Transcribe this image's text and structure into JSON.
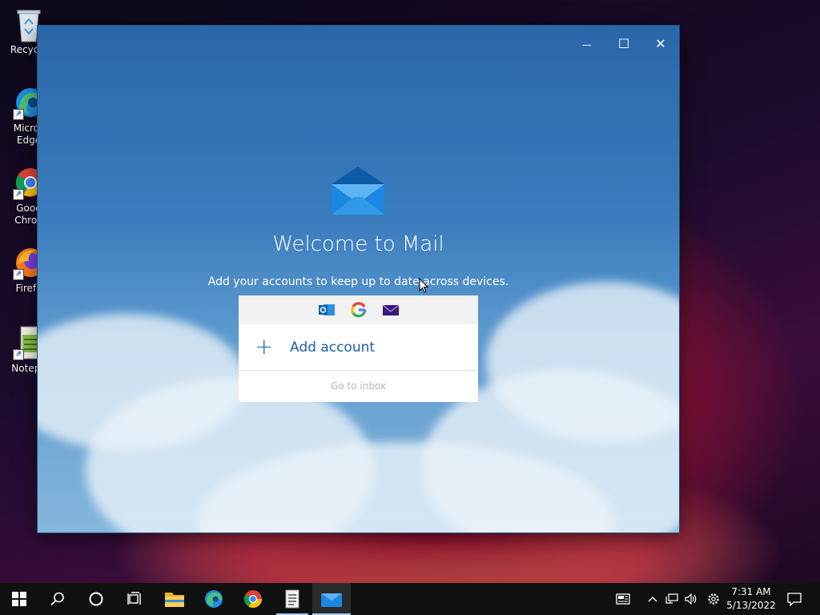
{
  "desktop": {
    "icons": [
      {
        "label": "Recycle",
        "icon": "recycle-bin-icon"
      },
      {
        "label": "Micros\nEdge",
        "line1": "Micros",
        "line2": "Edge",
        "icon": "edge-icon"
      },
      {
        "label": "Goog\nChron",
        "line1": "Goog",
        "line2": "Chron",
        "icon": "chrome-icon"
      },
      {
        "label": "Firefo",
        "icon": "firefox-icon"
      },
      {
        "label": "Notepa",
        "icon": "notepad-icon"
      }
    ]
  },
  "window": {
    "app": "Mail",
    "controls": {
      "minimize": "—",
      "maximize": "☐",
      "close": "✕"
    },
    "welcome_title": "Welcome to Mail",
    "welcome_subtitle": "Add your accounts to keep up to date across devices.",
    "providers": [
      "outlook-icon",
      "google-icon",
      "mail-icon"
    ],
    "add_account_label": "Add account",
    "add_account_icon": "plus-icon",
    "go_to_inbox_label": "Go to inbox"
  },
  "taskbar": {
    "apps": [
      "start-icon",
      "search-icon",
      "cortana-icon",
      "task-view-icon",
      "file-explorer-icon",
      "edge-icon",
      "chrome-icon",
      "notepad-icon",
      "mail-icon"
    ],
    "active_app": "mail-icon",
    "tray": [
      "news-icon",
      "chevron-up-icon",
      "network-icon",
      "volume-icon",
      "settings-icon"
    ],
    "time": "7:31 AM",
    "date": "5/13/2022",
    "notification_icon": "notification-icon"
  },
  "colors": {
    "accent": "#1d5fa8",
    "window_top": "#2a67a8",
    "taskbar": "#101010"
  }
}
